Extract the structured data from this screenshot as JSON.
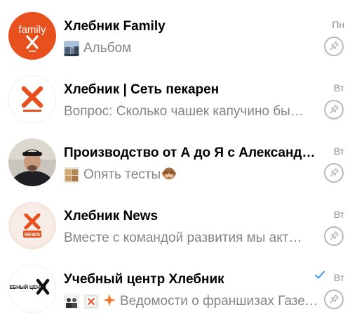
{
  "chats": [
    {
      "title": "Хлебник Family",
      "preview": "Альбом",
      "time": "Пн",
      "avatar_text": "family",
      "avatar_color": "#e8501e"
    },
    {
      "title": "Хлебник | Сеть пекарен",
      "preview": "Вопрос: Сколько чашек капучино бы…",
      "time": "Вт",
      "avatar_color": "#e8501e"
    },
    {
      "title": "Производство от А до Я с Александр…",
      "preview": "Опять тесты",
      "time": "Вт",
      "preview_emoji": "see-no-evil-monkey-icon"
    },
    {
      "title": "Хлебник News",
      "preview": "Вместе с командой развития мы акт…",
      "time": "Вт",
      "avatar_text": "NEWS",
      "avatar_color": "#e8501e"
    },
    {
      "title": "Учебный центр Хлебник",
      "preview": "Ведомости о франшизах Газет…",
      "time": "Вт",
      "avatar_text": "УЧЕБНЫЙ ЦЕНТР",
      "read_status": "read",
      "check_color": "#3390ec"
    }
  ],
  "colors": {
    "accent": "#e8501e",
    "title": "#000000",
    "preview": "#858585",
    "time": "#8f8f8f",
    "pin": "#b9b9b9"
  }
}
